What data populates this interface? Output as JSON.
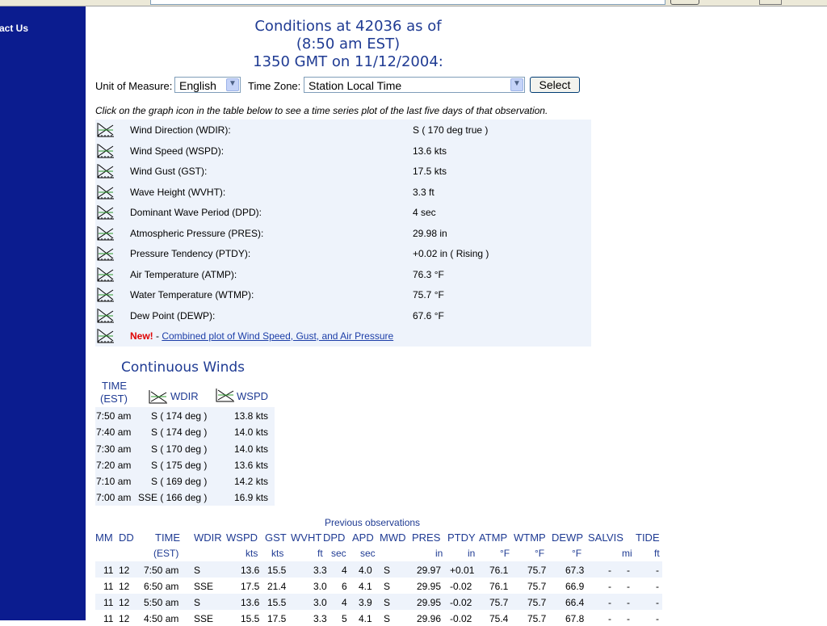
{
  "sidebar": {
    "link": "act Us"
  },
  "title": {
    "line1": "Conditions at 42036 as of",
    "line2": "(8:50 am EST)",
    "line3": "1350 GMT on 11/12/2004:"
  },
  "controls": {
    "unit_label": "Unit of Measure:",
    "unit_value": "English",
    "tz_label": "Time Zone:",
    "tz_value": "Station Local Time",
    "select_label": "Select"
  },
  "instruction": "Click on the graph icon in the table below to see a time series plot of the last five days of that observation.",
  "observations": [
    {
      "name": "Wind Direction (WDIR):",
      "value": "S ( 170 deg true )"
    },
    {
      "name": "Wind Speed (WSPD):",
      "value": "13.6 kts"
    },
    {
      "name": "Wind Gust (GST):",
      "value": "17.5 kts"
    },
    {
      "name": "Wave Height (WVHT):",
      "value": "3.3 ft"
    },
    {
      "name": "Dominant Wave Period (DPD):",
      "value": "4 sec"
    },
    {
      "name": "Atmospheric Pressure (PRES):",
      "value": "29.98 in"
    },
    {
      "name": "Pressure Tendency (PTDY):",
      "value": "+0.02 in ( Rising )"
    },
    {
      "name": "Air Temperature (ATMP):",
      "value": "76.3 °F"
    },
    {
      "name": "Water Temperature (WTMP):",
      "value": "75.7 °F"
    },
    {
      "name": "Dew Point (DEWP):",
      "value": "67.6 °F"
    }
  ],
  "combined": {
    "new_label": "New!",
    "sep": " - ",
    "link": "Combined plot of Wind Speed, Gust, and Air Pressure"
  },
  "continuous_winds": {
    "title": "Continuous Winds",
    "time_header_1": "TIME",
    "time_header_2": "(EST)",
    "wdir_header": "WDIR",
    "wspd_header": "WSPD",
    "rows": [
      {
        "time": "7:50 am",
        "wdir": "S ( 174 deg )",
        "wspd": "13.8 kts"
      },
      {
        "time": "7:40 am",
        "wdir": "S ( 174 deg )",
        "wspd": "14.0 kts"
      },
      {
        "time": "7:30 am",
        "wdir": "S ( 170 deg )",
        "wspd": "14.0 kts"
      },
      {
        "time": "7:20 am",
        "wdir": "S ( 175 deg )",
        "wspd": "13.6 kts"
      },
      {
        "time": "7:10 am",
        "wdir": "S ( 169 deg )",
        "wspd": "14.2 kts"
      },
      {
        "time": "7:00 am",
        "wdir": "SSE ( 166 deg )",
        "wspd": "16.9 kts"
      }
    ]
  },
  "previous": {
    "title": "Previous observations",
    "headers": [
      "MM",
      "DD",
      "TIME",
      "WDIR",
      "WSPD",
      "GST",
      "WVHT",
      "DPD",
      "APD",
      "MWD",
      "PRES",
      "PTDY",
      "ATMP",
      "WTMP",
      "DEWP",
      "SAL",
      "VIS",
      "TIDE"
    ],
    "units": [
      "(EST)",
      "kts",
      "kts",
      "ft",
      "sec",
      "sec",
      "in",
      "in",
      "°F",
      "°F",
      "°F",
      "mi",
      "ft"
    ],
    "rows": [
      [
        "11",
        "12",
        "7:50 am",
        "S",
        "13.6",
        "15.5",
        "3.3",
        "4",
        "4.0",
        "S",
        "29.97",
        "+0.01",
        "76.1",
        "75.7",
        "67.3",
        "-",
        "-",
        "-"
      ],
      [
        "11",
        "12",
        "6:50 am",
        "SSE",
        "17.5",
        "21.4",
        "3.0",
        "6",
        "4.1",
        "S",
        "29.95",
        "-0.02",
        "76.1",
        "75.7",
        "66.9",
        "-",
        "-",
        "-"
      ],
      [
        "11",
        "12",
        "5:50 am",
        "S",
        "13.6",
        "15.5",
        "3.0",
        "4",
        "3.9",
        "S",
        "29.95",
        "-0.02",
        "75.7",
        "75.7",
        "66.4",
        "-",
        "-",
        "-"
      ],
      [
        "11",
        "12",
        "4:50 am",
        "SSE",
        "15.5",
        "17.5",
        "3.3",
        "5",
        "4.1",
        "S",
        "29.96",
        "-0.02",
        "75.4",
        "75.7",
        "67.8",
        "-",
        "-",
        "-"
      ]
    ]
  }
}
